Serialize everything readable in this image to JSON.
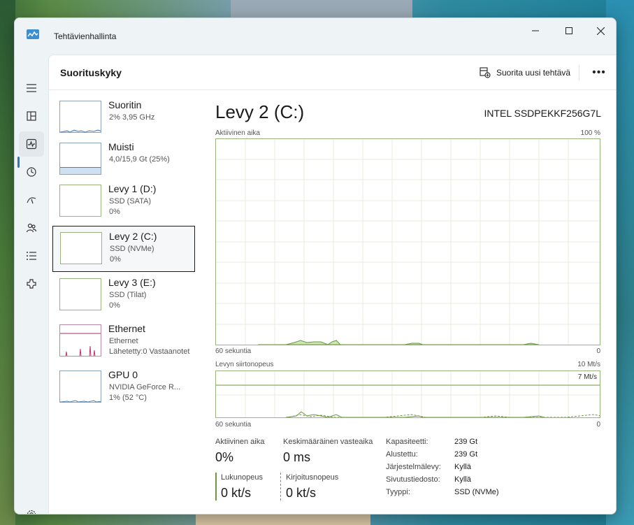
{
  "window": {
    "title": "Tehtävienhallinta"
  },
  "header": {
    "page_title": "Suorituskyky",
    "run_task_label": "Suorita uusi tehtävä",
    "more_label": "•••"
  },
  "devices": [
    {
      "name": "Suoritin",
      "line1": "2% 3,95 GHz",
      "line2": "",
      "color": "#4a7fb0"
    },
    {
      "name": "Muisti",
      "line1": "4,0/15,9 Gt (25%)",
      "line2": "",
      "color": "#4a7fb0"
    },
    {
      "name": "Levy 1 (D:)",
      "line1": "SSD (SATA)",
      "line2": "0%",
      "color": "#6a9a3a"
    },
    {
      "name": "Levy 2 (C:)",
      "line1": "SSD (NVMe)",
      "line2": "0%",
      "color": "#6a9a3a"
    },
    {
      "name": "Levy 3 (E:)",
      "line1": "SSD (Tilat)",
      "line2": "0%",
      "color": "#6a9a3a"
    },
    {
      "name": "Ethernet",
      "line1": "Ethernet",
      "line2": "Lähetetty:0 Vastaanotet",
      "color": "#a0306a"
    },
    {
      "name": "GPU 0",
      "line1": "NVIDIA GeForce R...",
      "line2": "1% (52 °C)",
      "color": "#4a7fb0"
    }
  ],
  "detail": {
    "title": "Levy 2 (C:)",
    "model": "INTEL SSDPEKKF256G7L",
    "graph1": {
      "label": "Aktiivinen aika",
      "max": "100 %",
      "xlabel": "60 sekuntia",
      "min": "0"
    },
    "graph2": {
      "label": "Levyn siirtonopeus",
      "max": "10 Mt/s",
      "line_label": "7 Mt/s",
      "xlabel": "60 sekuntia",
      "min": "0"
    },
    "stats": {
      "active_label": "Aktiivinen aika",
      "active_value": "0%",
      "response_label": "Keskimääräinen vasteaika",
      "response_value": "0 ms",
      "read_label": "Lukunopeus",
      "read_value": "0 kt/s",
      "write_label": "Kirjoitusnopeus",
      "write_value": "0 kt/s"
    },
    "properties": [
      {
        "key": "Kapasiteetti:",
        "value": "239 Gt"
      },
      {
        "key": "Alustettu:",
        "value": "239 Gt"
      },
      {
        "key": "Järjestelmälevy:",
        "value": "Kyllä"
      },
      {
        "key": "Sivutustiedosto:",
        "value": "Kyllä"
      },
      {
        "key": "Tyyppi:",
        "value": "SSD (NVMe)"
      }
    ]
  },
  "nav": {
    "icons": [
      "menu-icon",
      "processes-icon",
      "performance-icon",
      "app-history-icon",
      "startup-icon",
      "users-icon",
      "details-icon",
      "services-icon",
      "settings-icon"
    ]
  }
}
